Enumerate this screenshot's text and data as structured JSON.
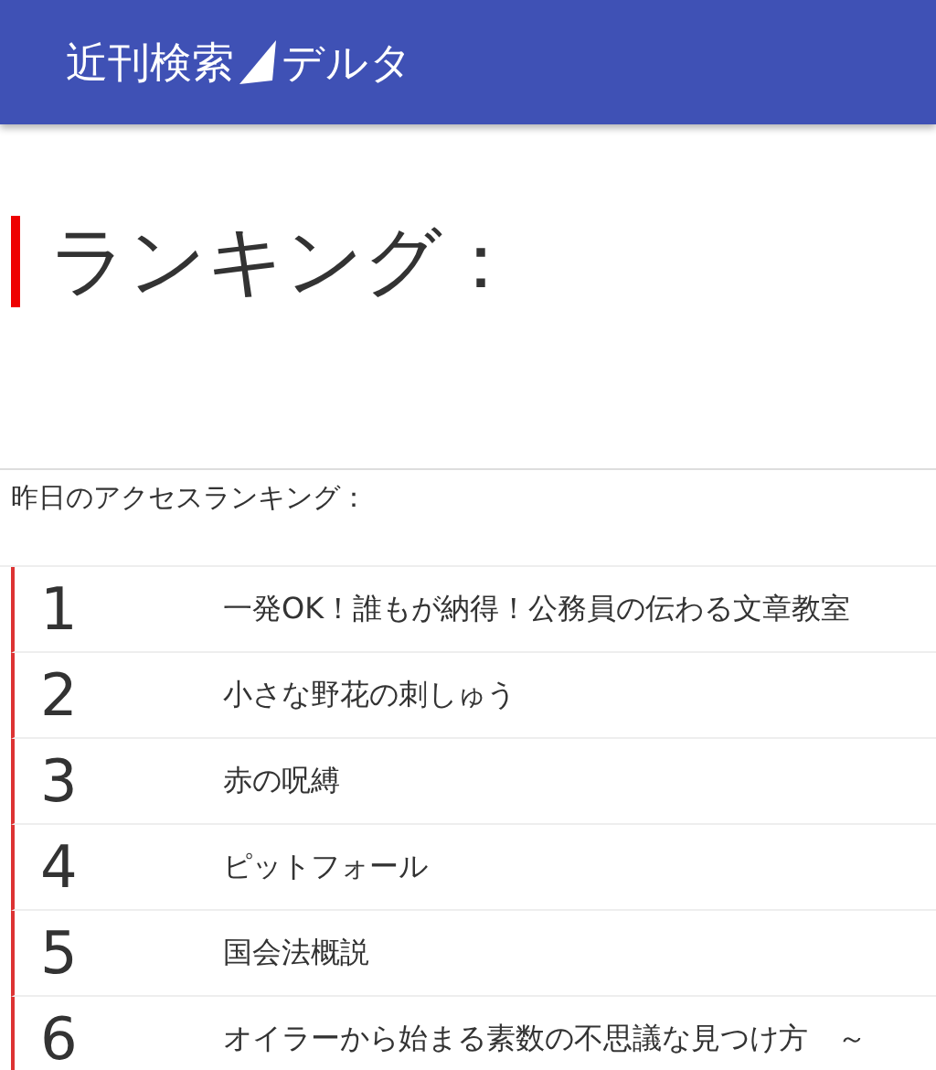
{
  "header": {
    "logo_left": "近刊検索",
    "logo_right": "デルタ"
  },
  "page_title": "ランキング：",
  "section_label": "昨日のアクセスランキング：",
  "ranking": [
    {
      "rank": "1",
      "title": "一発OK！誰もが納得！公務員の伝わる文章教室"
    },
    {
      "rank": "2",
      "title": "小さな野花の刺しゅう"
    },
    {
      "rank": "3",
      "title": "赤の呪縛"
    },
    {
      "rank": "4",
      "title": "ピットフォール"
    },
    {
      "rank": "5",
      "title": "国会法概説"
    },
    {
      "rank": "6",
      "title": "オイラーから始まる素数の不思議な見つけ方　～"
    }
  ]
}
